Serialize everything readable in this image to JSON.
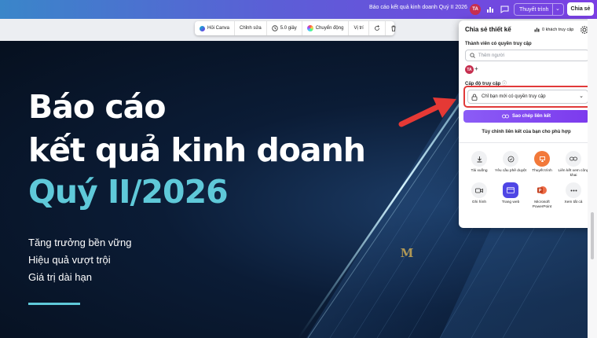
{
  "topbar": {
    "doc_title": "Báo cáo kết quả kinh doanh Quý II 2026",
    "avatar_initials": "TA",
    "present_label": "Thuyết trình",
    "share_label": "Chia sẻ",
    "icons": [
      "analytics-icon",
      "comment-icon",
      "chevron-down-icon"
    ]
  },
  "floating_toolbar": {
    "items": [
      {
        "label": "Hỏi Canva",
        "icon": "canva-ai-icon"
      },
      {
        "label": "Chỉnh sửa"
      },
      {
        "label": "5.0 giây",
        "icon": "timer-icon"
      },
      {
        "label": "Chuyển động",
        "icon": "animate-icon"
      },
      {
        "label": "Vị trí"
      }
    ]
  },
  "slide": {
    "title_line1": "Báo cáo",
    "title_line2": "kết quả kinh doanh",
    "title_line3": "Quý II/2026",
    "subtitles": [
      "Tăng trưởng bền vững",
      "Hiệu quả vượt trội",
      "Giá trị dài hạn"
    ],
    "watermark": "M",
    "accent_color": "#5fc9d9"
  },
  "share_panel": {
    "title": "Chia sẻ thiết kế",
    "visitors": "0 khách truy cập",
    "members_label": "Thành viên có quyền truy cập",
    "search_placeholder": "Thêm người",
    "member_initials": "TA",
    "access_label": "Cấp độ truy cập",
    "access_value": "Chỉ bạn mới có quyền truy cập",
    "copy_link_label": "Sao chép liên kết",
    "customize_label": "Tùy chỉnh liên kết của bạn cho phù hợp",
    "options": [
      {
        "label": "Tải xuống",
        "icon": "download-icon"
      },
      {
        "label": "Yêu cầu phê duyệt",
        "icon": "approval-icon"
      },
      {
        "label": "Thuyết trình",
        "icon": "present-icon"
      },
      {
        "label": "Liên kết xem công khai",
        "icon": "public-link-icon"
      },
      {
        "label": "Ghi hình",
        "icon": "record-icon"
      },
      {
        "label": "Trang web",
        "icon": "website-icon"
      },
      {
        "label": "Microsoft PowerPoint",
        "icon": "powerpoint-icon"
      },
      {
        "label": "Xem tất cả",
        "icon": "more-icon"
      }
    ],
    "highlight_color": "#e13a3a"
  }
}
